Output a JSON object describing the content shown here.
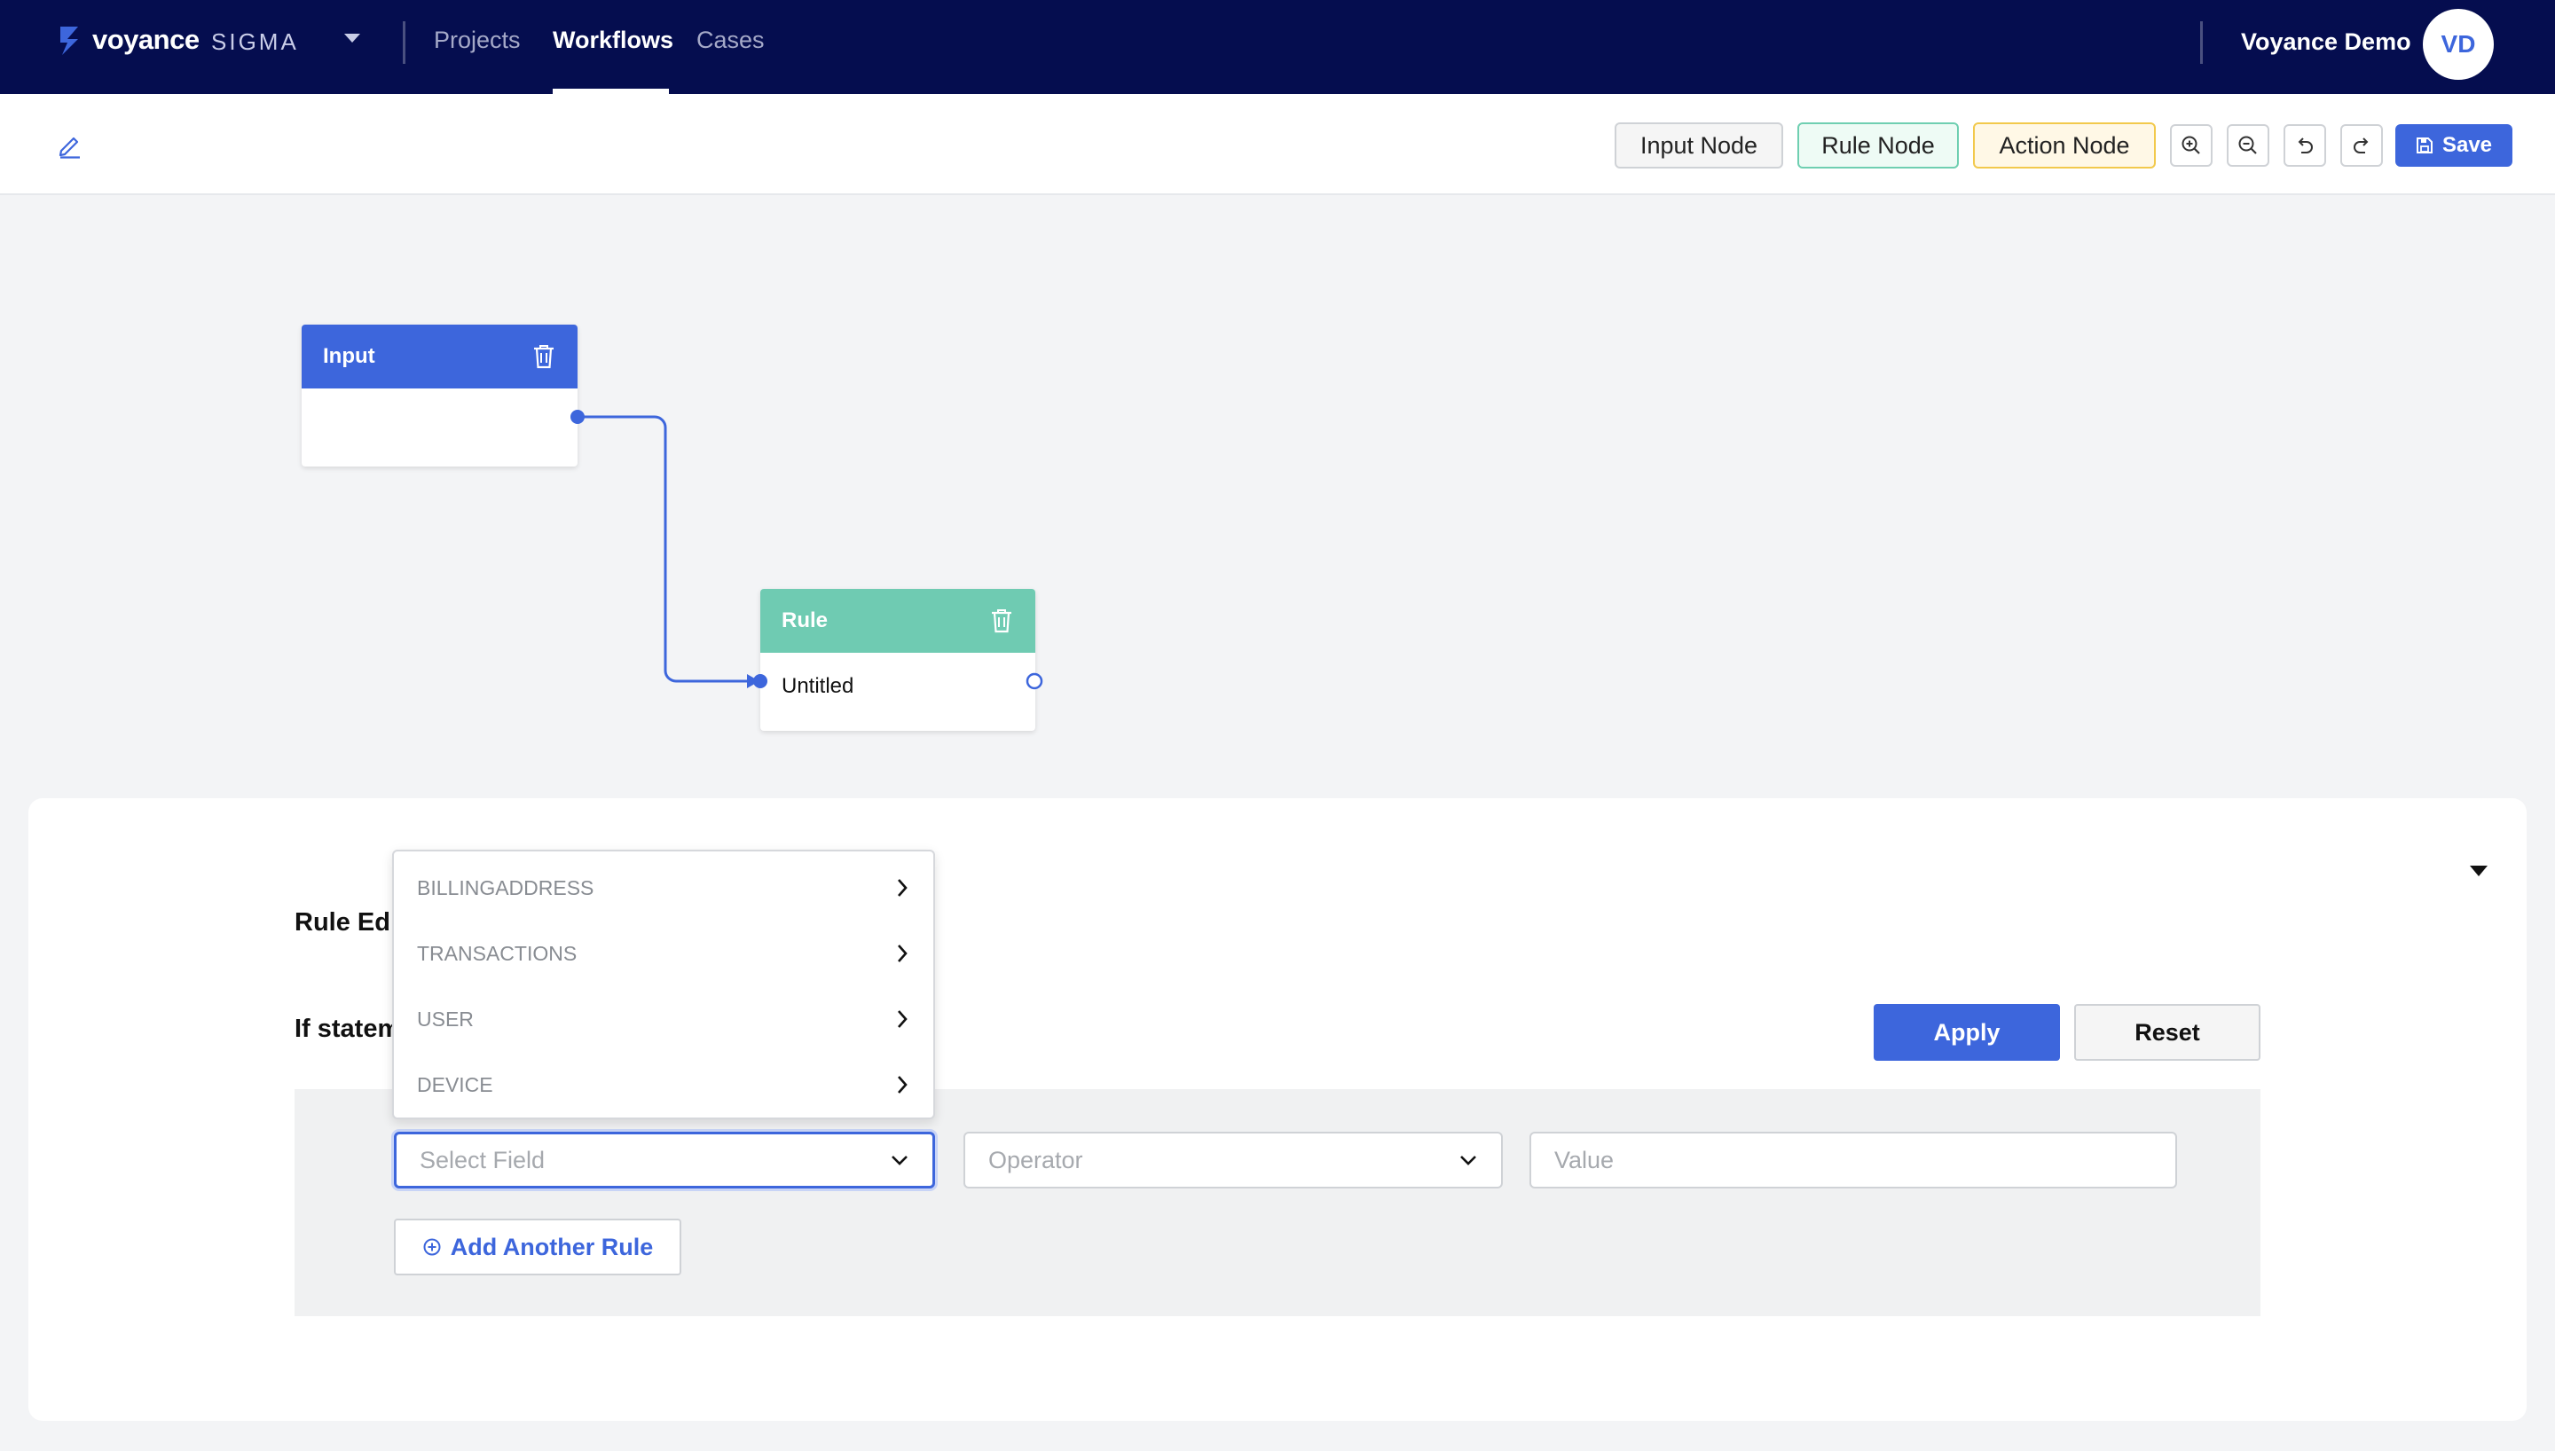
{
  "header": {
    "brand": "voyance",
    "brand_sub": "SIGMA",
    "nav": [
      "Projects",
      "Workflows",
      "Cases"
    ],
    "active_nav": "Workflows",
    "user_name": "Voyance Demo",
    "avatar_initials": "VD"
  },
  "toolbar": {
    "input_node_label": "Input Node",
    "rule_node_label": "Rule Node",
    "action_node_label": "Action Node",
    "save_label": "Save",
    "icons": [
      "zoom-in-icon",
      "zoom-out-icon",
      "undo-icon",
      "redo-icon"
    ]
  },
  "canvas": {
    "input_node": {
      "title": "Input"
    },
    "rule_node": {
      "title": "Rule",
      "name": "Untitled"
    }
  },
  "rule_editor": {
    "heading": "Rule Editor",
    "if_statement_label": "If statement",
    "apply_label": "Apply",
    "reset_label": "Reset",
    "select_field_placeholder": "Select Field",
    "operator_placeholder": "Operator",
    "value_placeholder": "Value",
    "add_rule_label": "Add Another Rule"
  },
  "field_dropdown": {
    "items": [
      "BILLINGADDRESS",
      "TRANSACTIONS",
      "USER",
      "DEVICE"
    ]
  },
  "colors": {
    "navbar": "#050d4f",
    "primary": "#3d66dc",
    "rule_node": "#6fcbb2",
    "action_node_border": "#f2c94c"
  }
}
